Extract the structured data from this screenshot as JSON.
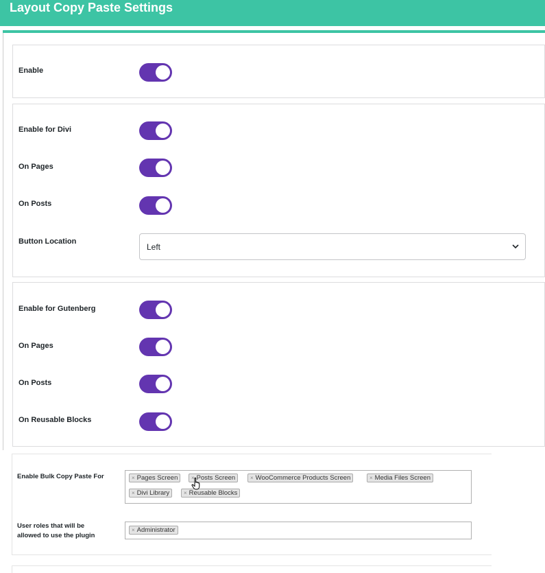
{
  "header": {
    "title": "Layout Copy Paste Settings"
  },
  "general": {
    "enable_label": "Enable",
    "enable_on": true
  },
  "divi": {
    "enable_label": "Enable for Divi",
    "on_pages_label": "On Pages",
    "on_posts_label": "On Posts",
    "button_location_label": "Button Location",
    "button_location_value": "Left"
  },
  "gutenberg": {
    "enable_label": "Enable for Gutenberg",
    "on_pages_label": "On Pages",
    "on_posts_label": "On Posts",
    "on_reusable_label": "On Reusable Blocks"
  },
  "bulk": {
    "label": "Enable Bulk Copy Paste For",
    "chips": [
      "Pages Screen",
      "Posts Screen",
      "WooCommerce Products Screen",
      "Media Files Screen",
      "Divi Library",
      "Reusable Blocks"
    ],
    "remove_glyph": "×"
  },
  "roles": {
    "label_line1": "User roles that will be",
    "label_line2": "allowed to use the plugin",
    "chips": [
      "Administrator"
    ]
  },
  "colors": {
    "accent": "#3dc4a4",
    "toggle": "#6335b0"
  },
  "icons": {
    "select_chevron": "chevron-down-icon",
    "cursor": "hand-pointer-icon"
  }
}
